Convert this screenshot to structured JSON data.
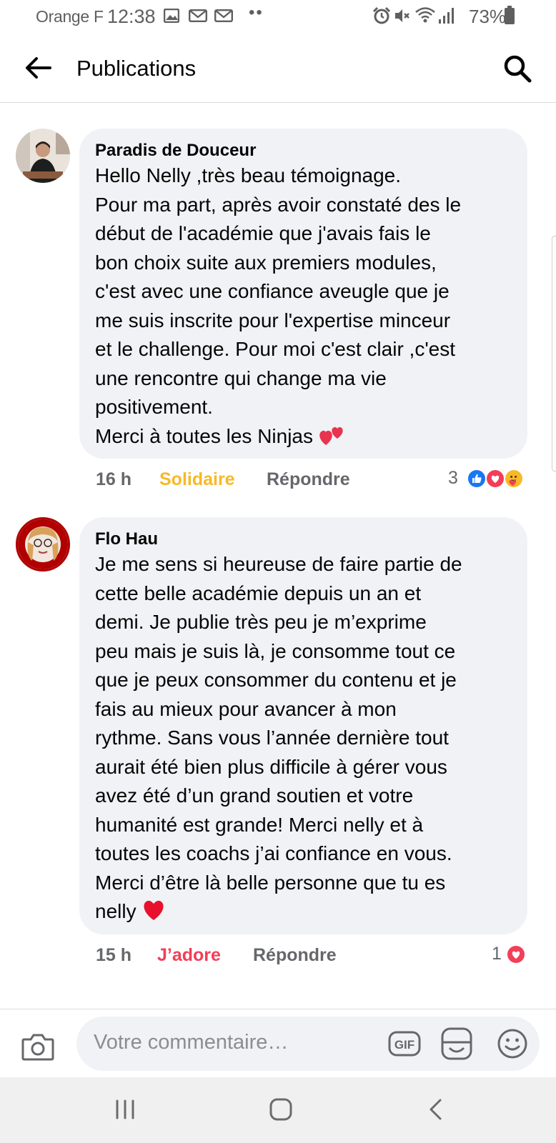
{
  "status_bar": {
    "carrier": "Orange F",
    "time": "12:38",
    "battery": "73%",
    "notification_icons": [
      "gallery-icon",
      "gmail-icon",
      "gmail-icon",
      "more-dots-icon"
    ],
    "system_icons": [
      "alarm-icon",
      "mute-icon",
      "wifi-icon",
      "signal-icon",
      "battery-icon"
    ],
    "more": "••"
  },
  "header": {
    "title": "Publications"
  },
  "comments": [
    {
      "author": "Paradis de Douceur",
      "text": "Hello Nelly ,très beau témoignage.\nPour ma part, après avoir constaté des le\ndébut de l'académie que j'avais fais le\nbon choix suite aux premiers modules,\nc'est avec une confiance aveugle que je\nme suis inscrite pour l'expertise minceur\net le challenge. Pour moi c'est clair ,c'est\nune rencontre qui change ma vie\npositivement.\nMerci à toutes les Ninjas",
      "time": "16 h",
      "reaction_label": "Solidaire",
      "reply_label": "Répondre",
      "reaction_count": "3",
      "reaction_color": "#f7b928",
      "reactions": [
        "like-icon",
        "love-icon",
        "care-icon"
      ]
    },
    {
      "author": "Flo Hau",
      "text": "Je me sens si heureuse de faire partie de\ncette belle académie depuis un an et\ndemi. Je publie très peu je m’exprime\npeu mais je suis là, je consomme tout ce\nque je peux consommer du contenu et je\nfais au mieux pour avancer à mon\nrythme. Sans vous l’année dernière tout\naurait été bien plus difficile à gérer vous\navez été d’un grand soutien et votre\nhumanité est grande! Merci nelly et à\ntoutes les coachs j’ai confiance en vous.\nMerci d’être là belle personne que tu es\nnelly",
      "time": "15 h",
      "reaction_label": "J’adore",
      "reply_label": "Répondre",
      "reaction_count": "1",
      "reaction_color": "#f33e58",
      "reactions": [
        "love-icon"
      ]
    }
  ],
  "composer": {
    "placeholder": "Votre commentaire…",
    "gif_label": "GIF"
  },
  "colors": {
    "bubble": "#f0f2f5",
    "secondary_text": "#65676b",
    "like_blue": "#1877f2",
    "love_red": "#f33e58",
    "care_yellow": "#f7b928"
  }
}
